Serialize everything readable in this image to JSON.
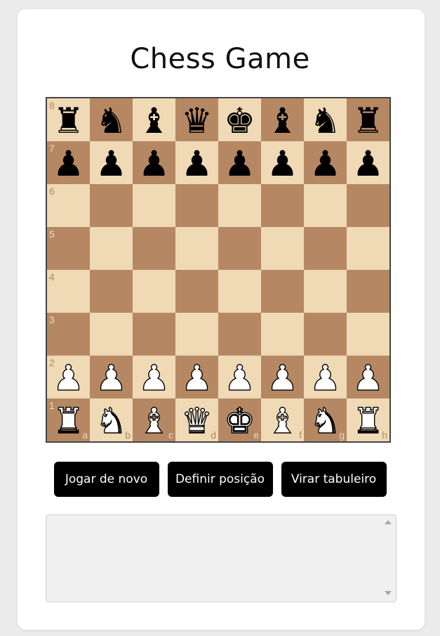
{
  "page": {
    "title": "Chess Game"
  },
  "board": {
    "light_color": "#f0d9b5",
    "dark_color": "#b58863",
    "files": [
      "a",
      "b",
      "c",
      "d",
      "e",
      "f",
      "g",
      "h"
    ],
    "ranks": [
      "8",
      "7",
      "6",
      "5",
      "4",
      "3",
      "2",
      "1"
    ],
    "position": [
      [
        "bR",
        "bN",
        "bB",
        "bQ",
        "bK",
        "bB",
        "bN",
        "bR"
      ],
      [
        "bP",
        "bP",
        "bP",
        "bP",
        "bP",
        "bP",
        "bP",
        "bP"
      ],
      [
        "",
        "",
        "",
        "",
        "",
        "",
        "",
        ""
      ],
      [
        "",
        "",
        "",
        "",
        "",
        "",
        "",
        ""
      ],
      [
        "",
        "",
        "",
        "",
        "",
        "",
        "",
        ""
      ],
      [
        "",
        "",
        "",
        "",
        "",
        "",
        "",
        ""
      ],
      [
        "wP",
        "wP",
        "wP",
        "wP",
        "wP",
        "wP",
        "wP",
        "wP"
      ],
      [
        "wR",
        "wN",
        "wB",
        "wQ",
        "wK",
        "wB",
        "wN",
        "wR"
      ]
    ],
    "piece_names": {
      "K": "king",
      "Q": "queen",
      "R": "rook",
      "B": "bishop",
      "N": "knight",
      "P": "pawn"
    }
  },
  "controls": {
    "play_again_label": "Jogar de novo",
    "set_position_label": "Definir posição",
    "flip_board_label": "Virar tabuleiro"
  },
  "log": {
    "value": ""
  }
}
